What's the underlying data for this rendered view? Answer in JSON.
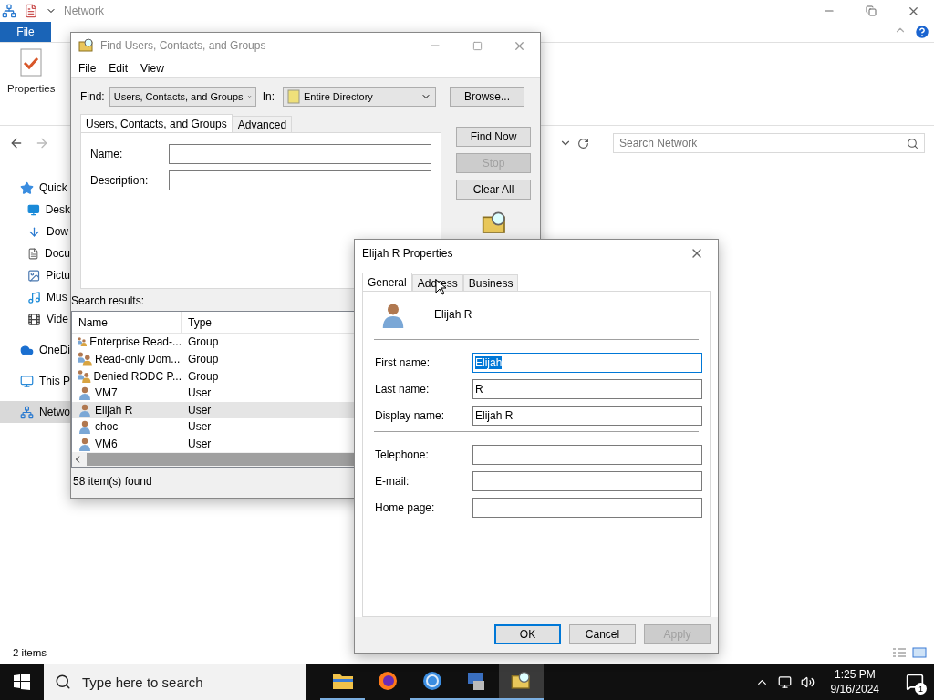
{
  "explorer": {
    "title": "Network",
    "file_tab": "File",
    "ribbon_button": "Properties",
    "search": {
      "placeholder": "Search Network"
    },
    "nav": [
      {
        "label": "Quick",
        "kind": "star",
        "selected": false
      },
      {
        "label": "Desk",
        "kind": "desktop",
        "selected": false
      },
      {
        "label": "Dow",
        "kind": "download",
        "selected": false
      },
      {
        "label": "Docu",
        "kind": "document",
        "selected": false
      },
      {
        "label": "Pictu",
        "kind": "picture",
        "selected": false
      },
      {
        "label": "Mus",
        "kind": "music",
        "selected": false
      },
      {
        "label": "Vide",
        "kind": "video",
        "selected": false
      },
      {
        "label": "OneDi",
        "kind": "cloud",
        "selected": false
      },
      {
        "label": "This P",
        "kind": "pc",
        "selected": false
      },
      {
        "label": "Netwo",
        "kind": "network",
        "selected": true
      }
    ],
    "status": "2 items"
  },
  "find_dialog": {
    "title": "Find Users, Contacts, and Groups",
    "menu": [
      "File",
      "Edit",
      "View"
    ],
    "find_label": "Find:",
    "find_value": "Users, Contacts, and Groups",
    "in_label": "In:",
    "in_value": "Entire Directory",
    "browse": "Browse...",
    "tabs": [
      {
        "label": "Users, Contacts, and Groups",
        "selected": true
      },
      {
        "label": "Advanced",
        "selected": false
      }
    ],
    "fields": [
      {
        "label": "Name:"
      },
      {
        "label": "Description:"
      }
    ],
    "buttons": [
      {
        "label": "Find Now",
        "disabled": false
      },
      {
        "label": "Stop",
        "disabled": true
      },
      {
        "label": "Clear All",
        "disabled": false
      }
    ],
    "results_label": "Search results:",
    "columns": [
      "Name",
      "Type"
    ],
    "rows": [
      {
        "name": "Enterprise Read-...",
        "type": "Group",
        "kind": "group",
        "selected": false
      },
      {
        "name": "Read-only Dom...",
        "type": "Group",
        "kind": "group",
        "selected": false
      },
      {
        "name": "Denied RODC P...",
        "type": "Group",
        "kind": "group",
        "selected": false
      },
      {
        "name": "VM7",
        "type": "User",
        "kind": "user",
        "selected": false
      },
      {
        "name": "Elijah R",
        "type": "User",
        "kind": "user",
        "selected": true
      },
      {
        "name": "choc",
        "type": "User",
        "kind": "user",
        "selected": false
      },
      {
        "name": "VM6",
        "type": "User",
        "kind": "user",
        "selected": false
      }
    ],
    "status": "58 item(s) found"
  },
  "properties_dialog": {
    "title": "Elijah R Properties",
    "tabs": [
      {
        "label": "General",
        "selected": true
      },
      {
        "label": "Address",
        "selected": false
      },
      {
        "label": "Business",
        "selected": false
      }
    ],
    "display_name": "Elijah R",
    "field_groups": [
      [
        {
          "label": "First name:",
          "value": "Elijah",
          "focused": true
        },
        {
          "label": "Last name:",
          "value": "R",
          "focused": false
        },
        {
          "label": "Display name:",
          "value": "Elijah R",
          "focused": false
        }
      ],
      [
        {
          "label": "Telephone:",
          "focused": false
        },
        {
          "label": "E-mail:",
          "focused": false
        },
        {
          "label": "Home page:",
          "focused": false
        }
      ]
    ],
    "buttons": [
      {
        "label": "OK",
        "default": true,
        "disabled": false
      },
      {
        "label": "Cancel",
        "default": false,
        "disabled": false
      },
      {
        "label": "Apply",
        "default": false,
        "disabled": true
      }
    ]
  },
  "taskbar": {
    "search_placeholder": "Type here to search",
    "apps": [
      {
        "kind": "folder",
        "running": true,
        "selected": false
      },
      {
        "kind": "firefox",
        "running": false,
        "selected": false
      },
      {
        "kind": "chrome",
        "running": true,
        "selected": false
      },
      {
        "kind": "server",
        "running": true,
        "selected": false
      },
      {
        "kind": "find",
        "running": true,
        "selected": true
      }
    ],
    "time": "1:25 PM",
    "date": "9/16/2024",
    "notification_count": "1"
  }
}
